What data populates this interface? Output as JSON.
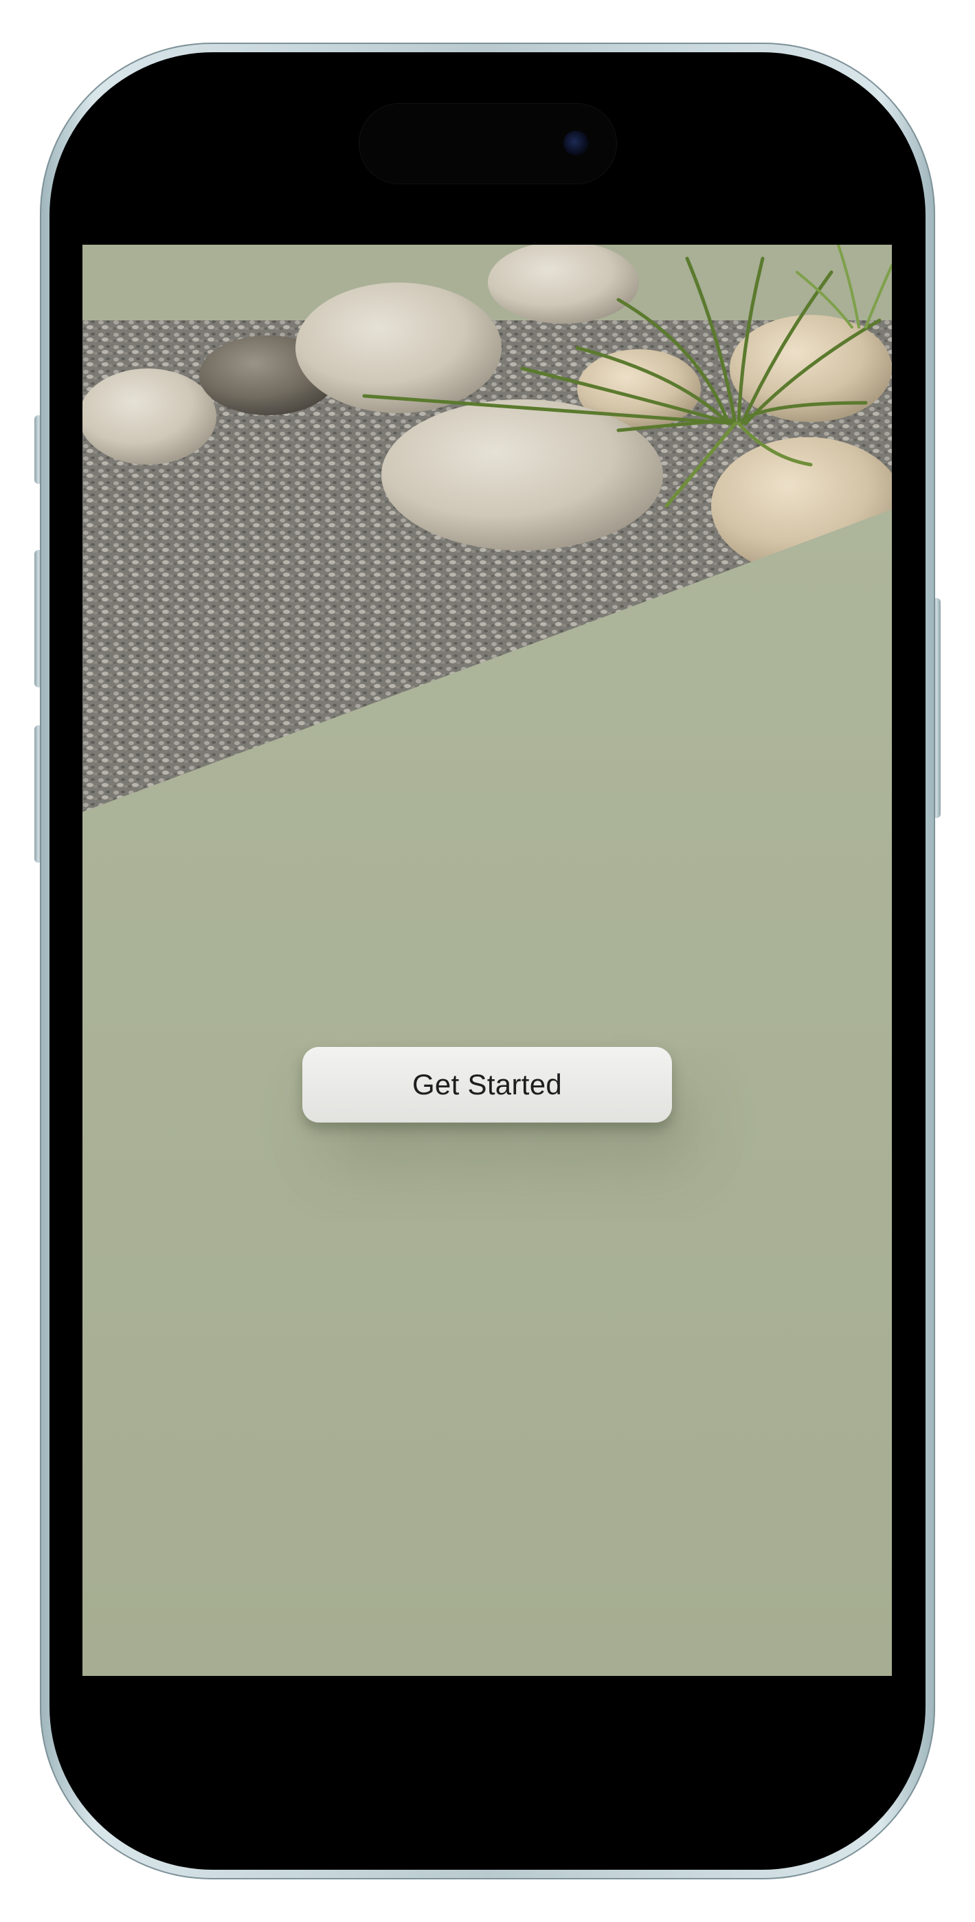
{
  "app": {
    "hero_image": "zen-garden-stones-and-grass",
    "cta_label": "Get Started"
  },
  "colors": {
    "background_green": "#aab39a",
    "button_fill": "#ebebe8",
    "button_text": "#1e1e1e",
    "device_frame": "#b9cacf"
  }
}
